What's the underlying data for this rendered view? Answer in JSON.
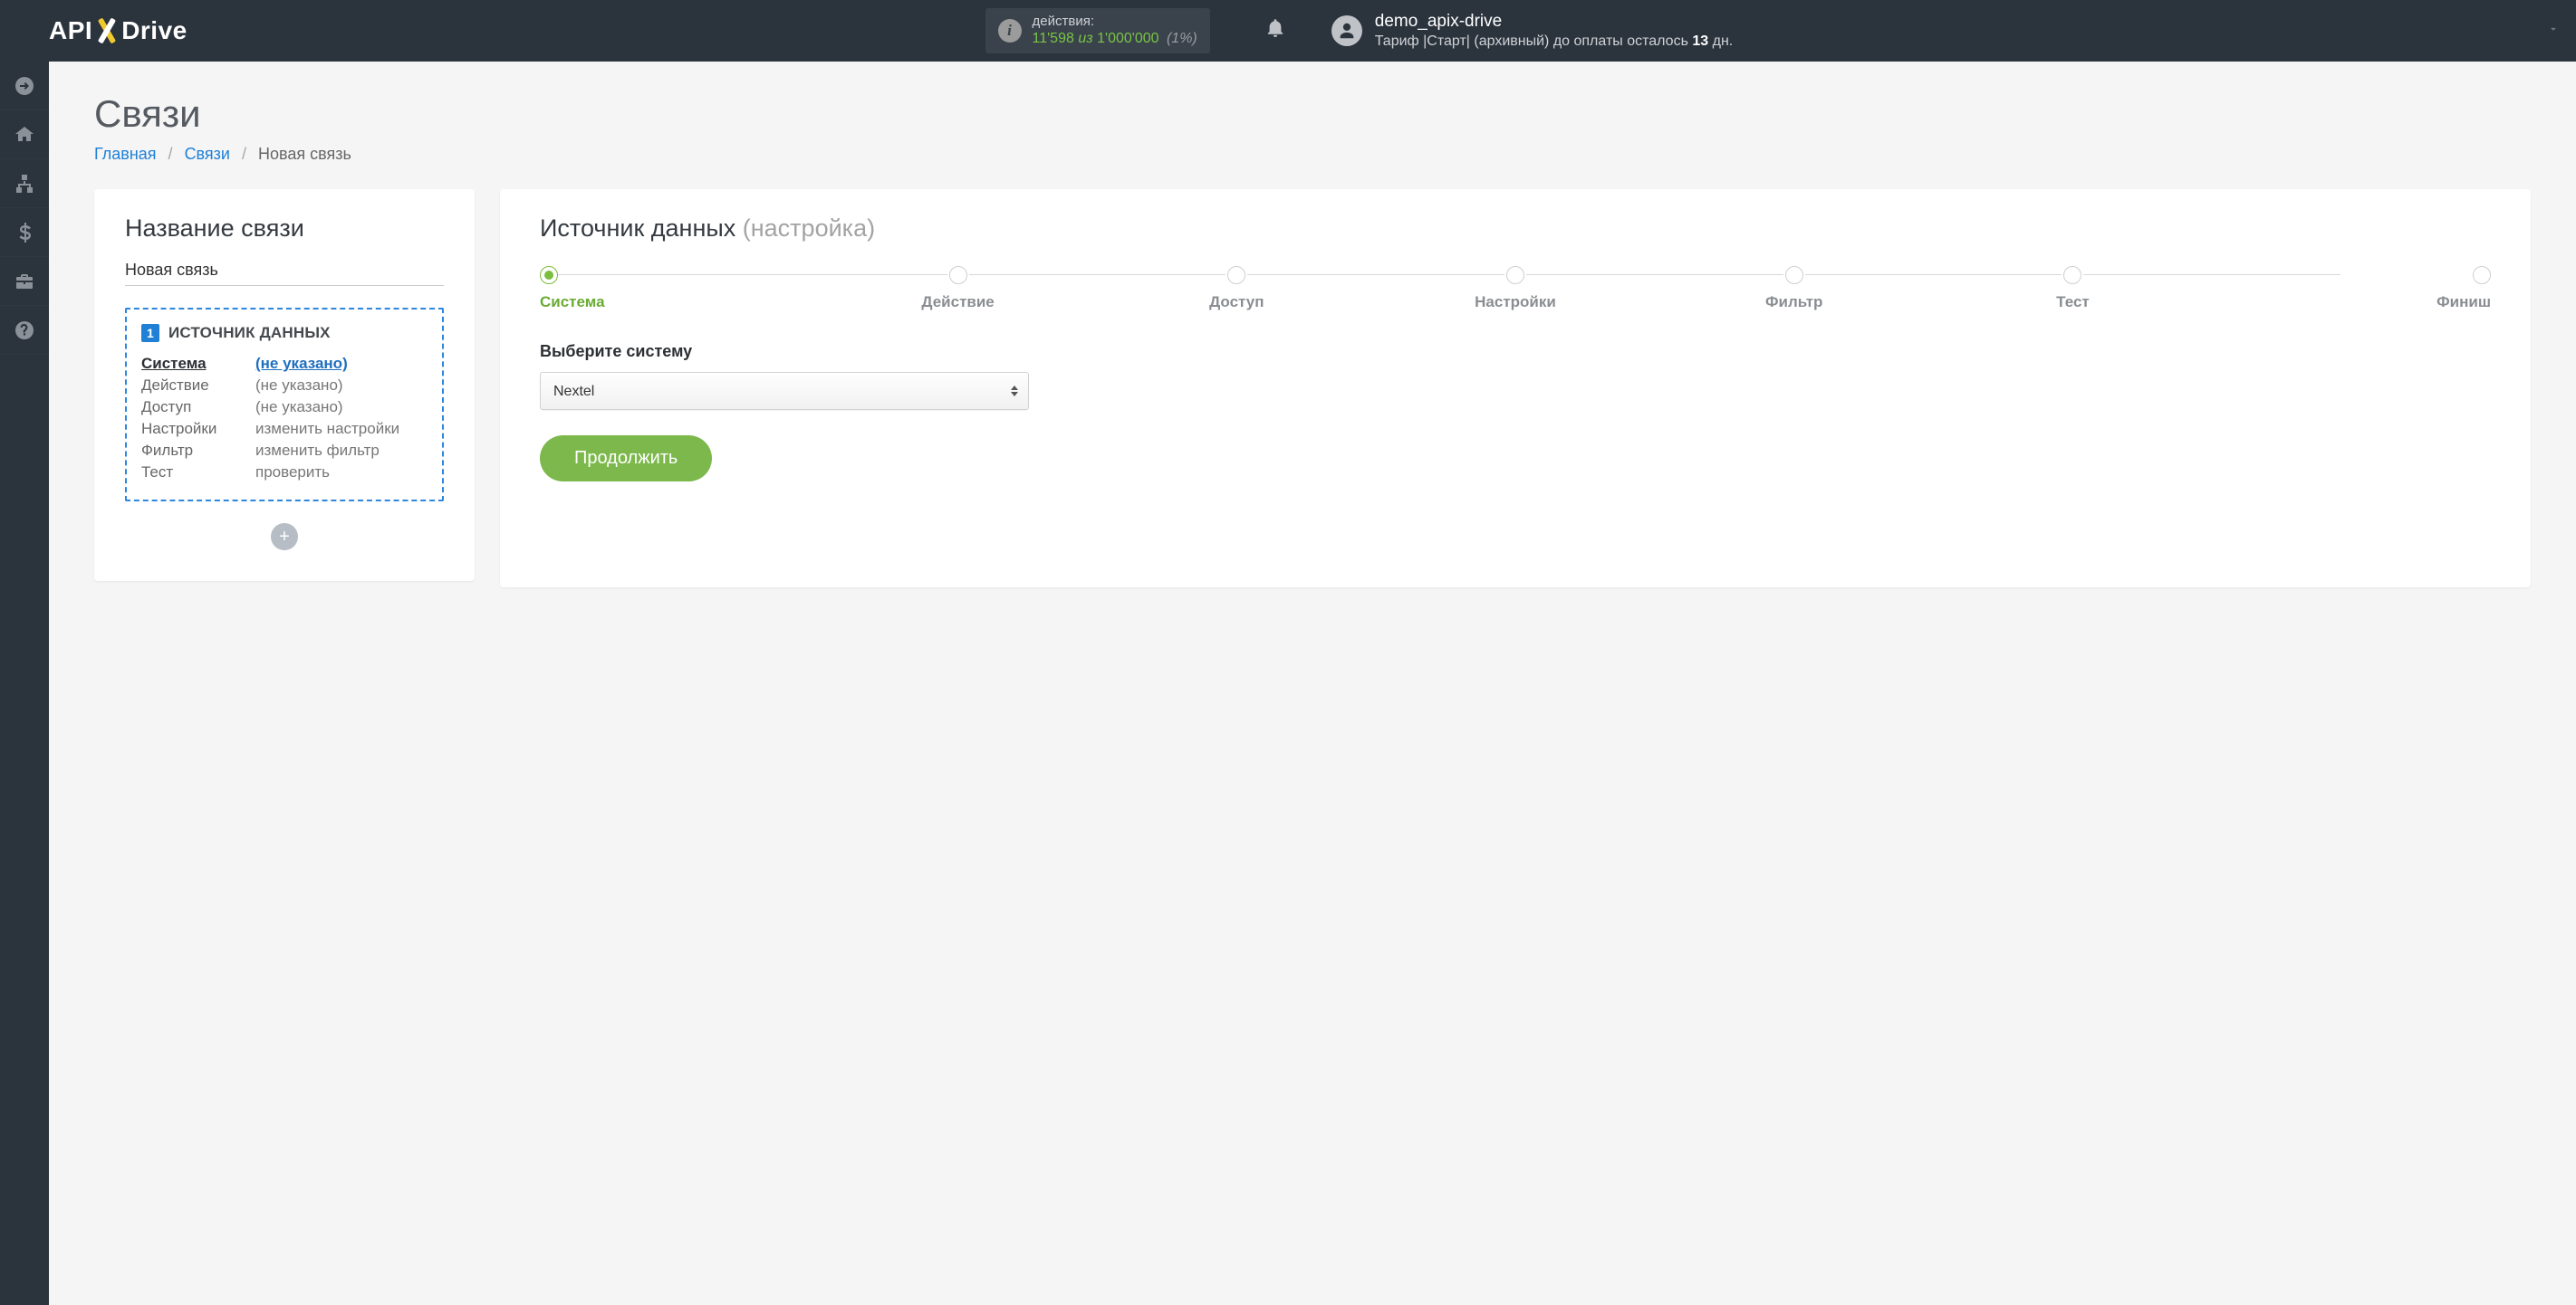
{
  "header": {
    "logo": {
      "part1": "API",
      "part2": "Drive"
    },
    "actions": {
      "label": "действия:",
      "used": "11'598",
      "sep": "из",
      "total": "1'000'000",
      "percent": "(1%)"
    },
    "user": {
      "name": "demo_apix-drive",
      "plan_prefix": "Тариф |Старт| (архивный) до оплаты осталось ",
      "plan_bold": "13",
      "plan_suffix": " дн."
    }
  },
  "page": {
    "title": "Связи",
    "breadcrumb": {
      "home": "Главная",
      "links": "Связи",
      "current": "Новая связь"
    }
  },
  "left": {
    "heading": "Название связи",
    "name_value": "Новая связь",
    "box_title": "ИСТОЧНИК ДАННЫХ",
    "box_number": "1",
    "rows": [
      {
        "key": "Система",
        "val": "(не указано)",
        "active": true
      },
      {
        "key": "Действие",
        "val": "(не указано)"
      },
      {
        "key": "Доступ",
        "val": "(не указано)"
      },
      {
        "key": "Настройки",
        "val": "изменить настройки"
      },
      {
        "key": "Фильтр",
        "val": "изменить фильтр"
      },
      {
        "key": "Тест",
        "val": "проверить"
      }
    ],
    "add_label": "+"
  },
  "right": {
    "heading_main": "Источник данных ",
    "heading_muted": "(настройка)",
    "steps": [
      {
        "label": "Система",
        "active": true
      },
      {
        "label": "Действие"
      },
      {
        "label": "Доступ"
      },
      {
        "label": "Настройки"
      },
      {
        "label": "Фильтр"
      },
      {
        "label": "Тест"
      },
      {
        "label": "Финиш"
      }
    ],
    "field_label": "Выберите систему",
    "select_value": "Nextel",
    "continue": "Продолжить"
  }
}
